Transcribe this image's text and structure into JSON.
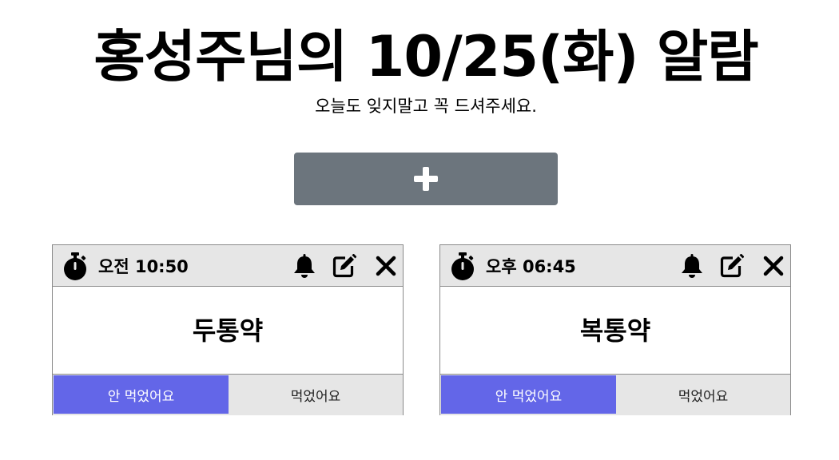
{
  "header": {
    "title": "홍성주님의 10/25(화) 알람",
    "subtitle": "오늘도 잊지말고 꼭 드셔주세요."
  },
  "add_button": {
    "icon": "plus-icon",
    "color": "#6c757d"
  },
  "alarms": [
    {
      "time": "오전 10:50",
      "medicine": "두통약",
      "not_taken_label": "안 먹었어요",
      "taken_label": "먹었어요",
      "status": "not_taken"
    },
    {
      "time": "오후 06:45",
      "medicine": "복통약",
      "not_taken_label": "안 먹었어요",
      "taken_label": "먹었어요",
      "status": "not_taken"
    }
  ],
  "colors": {
    "accent": "#6366e8",
    "header_bg": "#e6e6e6",
    "border": "#8a8a8a"
  }
}
